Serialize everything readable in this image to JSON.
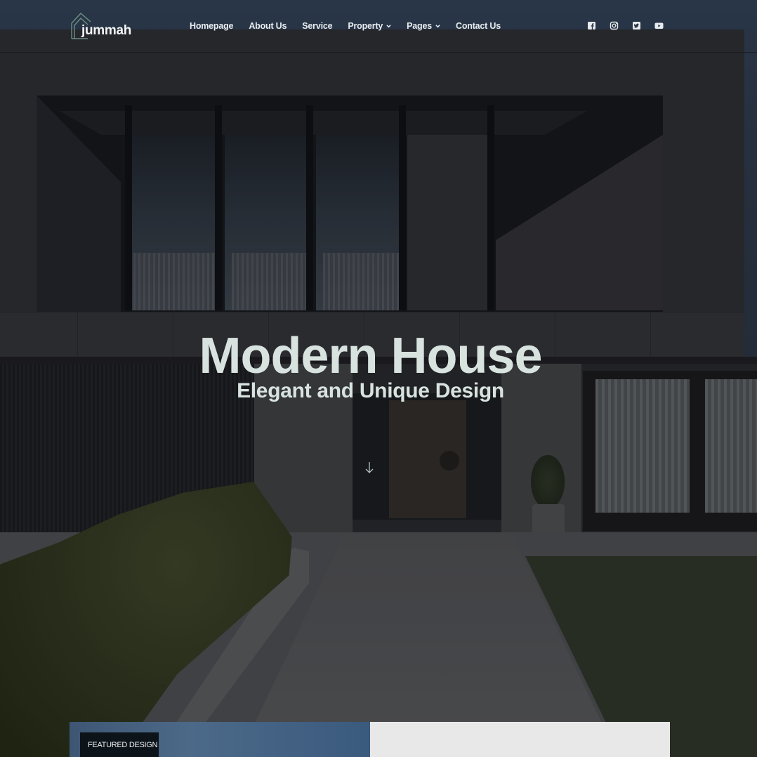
{
  "brand": {
    "name": "jummah",
    "logo_icon": "house-outline-icon",
    "accent_color": "#6b8f84"
  },
  "nav": {
    "items": [
      {
        "label": "Homepage",
        "has_dropdown": false
      },
      {
        "label": "About Us",
        "has_dropdown": false
      },
      {
        "label": "Service",
        "has_dropdown": false
      },
      {
        "label": "Property",
        "has_dropdown": true
      },
      {
        "label": "Pages",
        "has_dropdown": true
      },
      {
        "label": "Contact Us",
        "has_dropdown": false
      }
    ]
  },
  "social": [
    {
      "icon": "facebook-icon"
    },
    {
      "icon": "instagram-icon"
    },
    {
      "icon": "twitter-icon"
    },
    {
      "icon": "youtube-icon"
    }
  ],
  "hero": {
    "title": "Modern House",
    "subtitle": "Elegant and Unique Design",
    "scroll_icon": "arrow-down-icon",
    "text_color": "#d8e2df"
  },
  "featured": {
    "badge": "FEATURED DESIGN"
  }
}
